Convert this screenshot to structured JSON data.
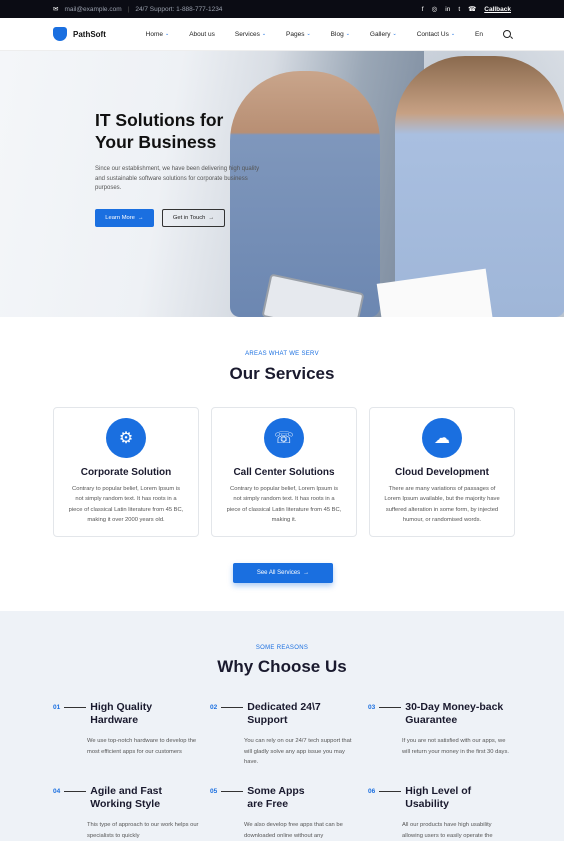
{
  "topbar": {
    "email": "mail@example.com",
    "support": "24/7 Support: 1-888-777-1234",
    "social": [
      "facebook-icon",
      "instagram-icon",
      "linkedin-icon",
      "twitter-icon"
    ],
    "callback": "Callback"
  },
  "nav": {
    "brand": "PathSoft",
    "items": [
      {
        "label": "Home",
        "dropdown": true
      },
      {
        "label": "About us",
        "dropdown": false
      },
      {
        "label": "Services",
        "dropdown": true
      },
      {
        "label": "Pages",
        "dropdown": true
      },
      {
        "label": "Blog",
        "dropdown": true
      },
      {
        "label": "Gallery",
        "dropdown": true
      },
      {
        "label": "Contact Us",
        "dropdown": true
      }
    ],
    "lang": "En"
  },
  "hero": {
    "title_line1": "IT Solutions for",
    "title_line2": "Your Business",
    "text": "Since our establishment, we have been delivering high quality and sustainable software solutions for corporate business purposes.",
    "primary_btn": "Learn More",
    "secondary_btn": "Get in Touch"
  },
  "services": {
    "eyebrow": "AREAS WHAT WE SERV",
    "title": "Our Services",
    "cards": [
      {
        "icon": "gear-icon",
        "title": "Corporate Solution",
        "text": "Contrary to popular belief, Lorem Ipsum is not simply random text. It has roots in a piece of classical Latin literature from 45 BC, making it over 2000 years old."
      },
      {
        "icon": "phone-icon",
        "title": "Call Center Solutions",
        "text": "Contrary to popular belief, Lorem Ipsum is not simply random text. It has roots in a piece of classical Latin literature from 45 BC, making it."
      },
      {
        "icon": "cloud-download-icon",
        "title": "Cloud Development",
        "text": "There are many variations of passages of Lorem Ipsum available, but the majority have suffered alteration in some form, by injected humour, or randomised words."
      }
    ],
    "see_all": "See All Services"
  },
  "why": {
    "eyebrow": "SOME REASONS",
    "title": "Why Choose Us",
    "features": [
      {
        "num": "01",
        "title": "High Quality Hardware",
        "text": "We use top-notch hardware to develop the most efficient apps for our customers"
      },
      {
        "num": "02",
        "title": "Dedicated 24\\7 Support",
        "text": "You can rely on our 24/7 tech support that will gladly solve any app issue you may have."
      },
      {
        "num": "03",
        "title": "30-Day Money-back Guarantee",
        "text": "If you are not satisfied with our apps, we will return your money in the first 30 days."
      },
      {
        "num": "04",
        "title": "Agile and Fast Working Style",
        "text": "This type of approach to our work helps our specialists to quickly"
      },
      {
        "num": "05",
        "title": "Some Apps are Free",
        "text": "We also develop free apps that can be downloaded online without any"
      },
      {
        "num": "06",
        "title": "High Level of Usability",
        "text": "All our products have high usability allowing users to easily operate the"
      }
    ]
  },
  "colors": {
    "accent": "#1a6fe0",
    "topbar_bg": "#0b0c14",
    "why_bg": "#eef2f7"
  }
}
